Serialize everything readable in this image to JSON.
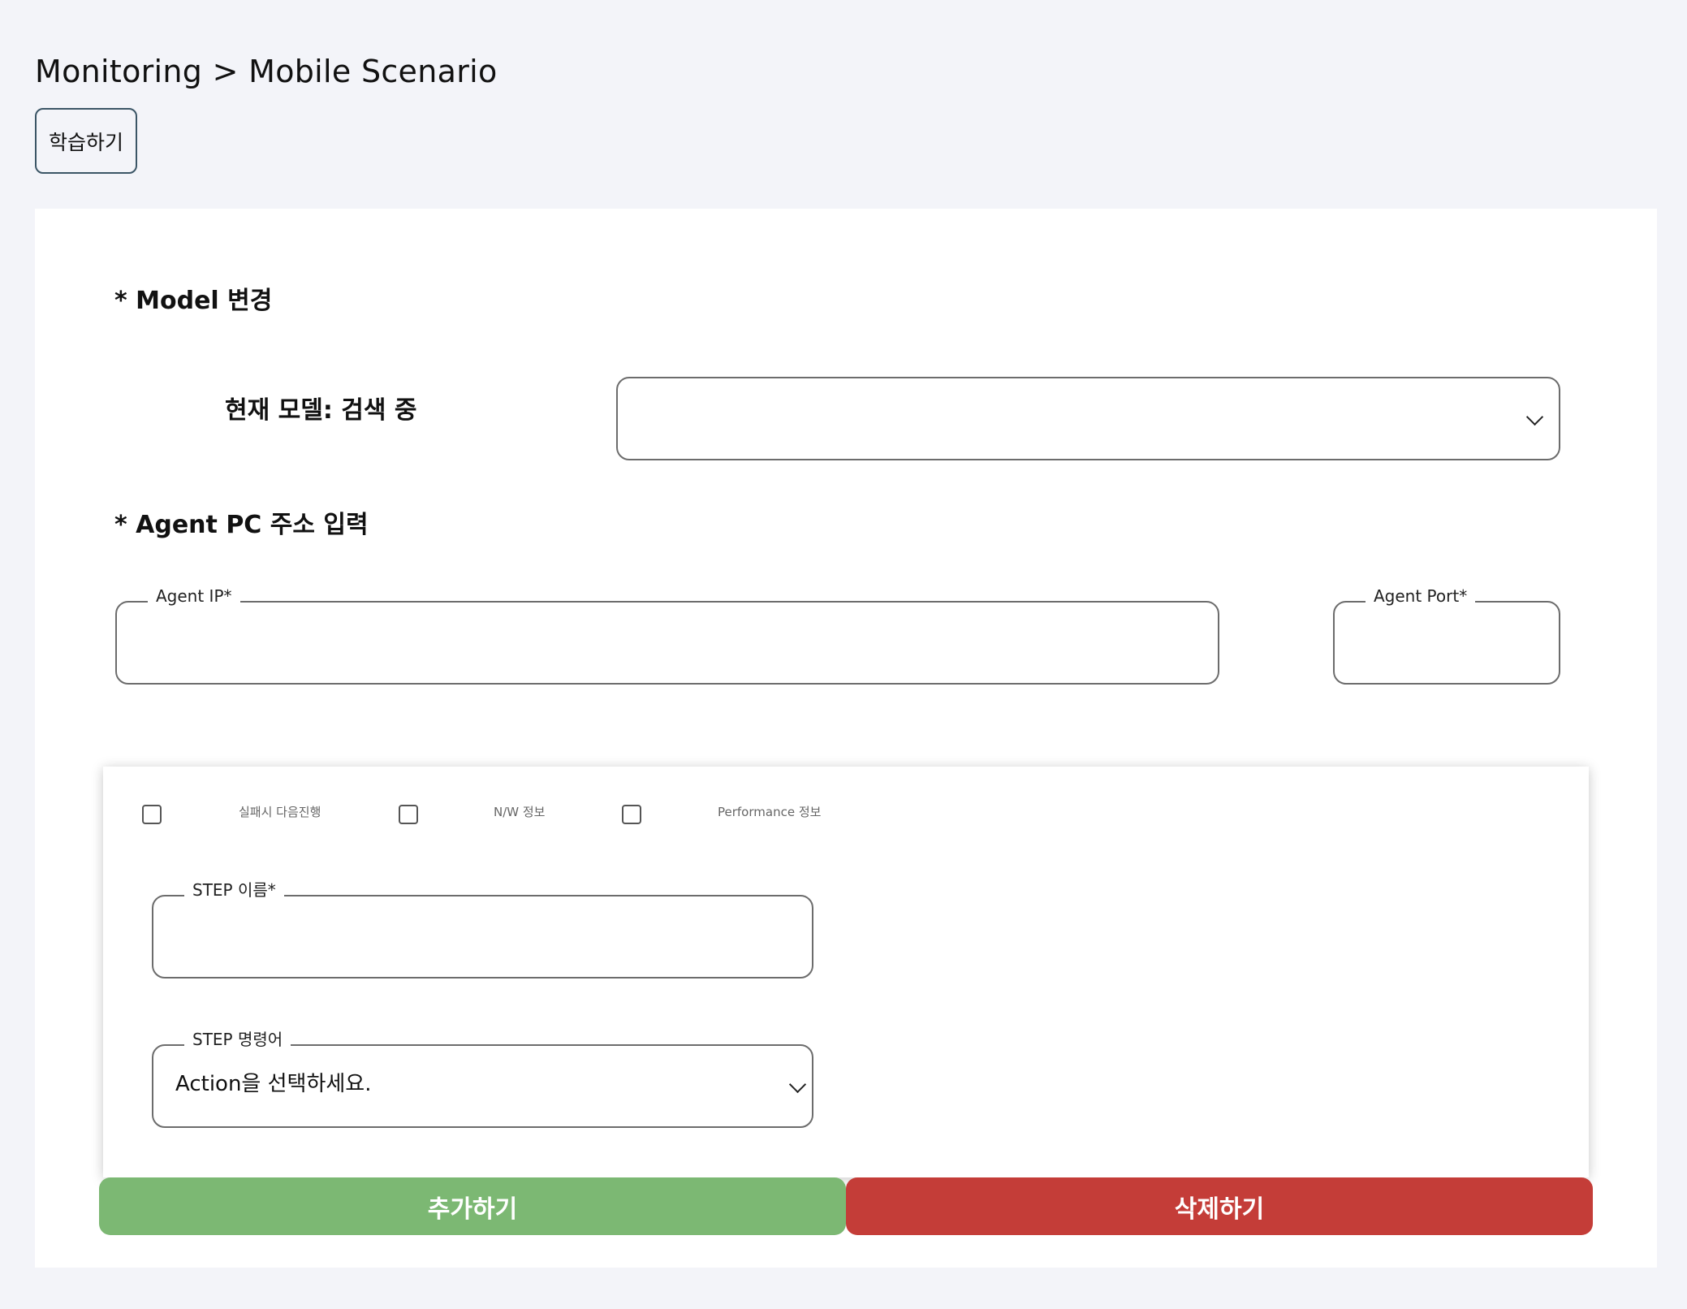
{
  "header": {
    "breadcrumb": "Monitoring > Mobile Scenario",
    "learn_button": "학습하기"
  },
  "model_section": {
    "title": "* Model 변경",
    "current_model_label": "현재 모델: 검색 중",
    "model_select_value": "",
    "chevron_icon": "chevron-down-icon"
  },
  "agent_section": {
    "title": "* Agent PC 주소 입력",
    "ip_label": "Agent IP*",
    "ip_value": "",
    "port_label": "Agent Port*",
    "port_value": ""
  },
  "step": {
    "checkboxes": [
      {
        "label": "실패시 다음진행",
        "checked": false
      },
      {
        "label": "N/W 정보",
        "checked": false
      },
      {
        "label": "Performance 정보",
        "checked": false
      }
    ],
    "name_label": "STEP 이름*",
    "name_value": "",
    "command_label": "STEP 명령어",
    "command_value": "Action을 선택하세요."
  },
  "actions": {
    "add_label": "추가하기",
    "delete_label": "삭제하기"
  },
  "colors": {
    "page_bg": "#f3f4f9",
    "add_button": "#7cb873",
    "delete_button": "#c43d38",
    "learn_border": "#3b5566"
  }
}
